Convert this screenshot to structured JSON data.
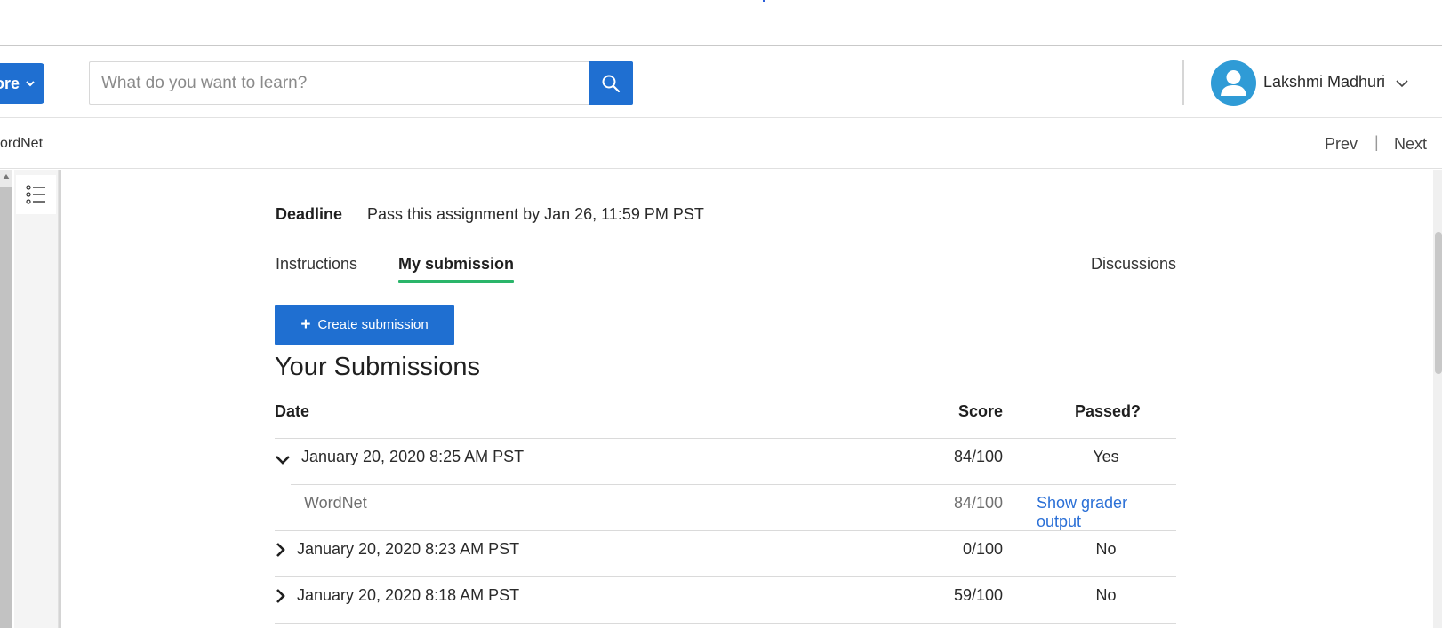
{
  "header": {
    "explore_label": "ore",
    "search_placeholder": "What do you want to learn?",
    "user_name": "Lakshmi Madhuri"
  },
  "subbar": {
    "breadcrumb": "ordNet",
    "prev_label": "Prev",
    "separator": "|",
    "next_label": "Next"
  },
  "assignment": {
    "deadline_label": "Deadline",
    "deadline_text": "Pass this assignment by Jan 26, 11:59 PM PST"
  },
  "tabs": [
    {
      "label": "Instructions",
      "active": false
    },
    {
      "label": "My submission",
      "active": true
    },
    {
      "label": "Discussions",
      "active": false
    }
  ],
  "create_submission_label": "Create submission",
  "submissions": {
    "title": "Your Submissions",
    "columns": {
      "date": "Date",
      "score": "Score",
      "passed": "Passed?"
    },
    "rows": [
      {
        "date": "January 20, 2020 8:25 AM PST",
        "score": "84/100",
        "passed": "Yes",
        "expanded": true,
        "detail": {
          "name": "WordNet",
          "score": "84/100",
          "link": "Show grader output"
        }
      },
      {
        "date": "January 20, 2020 8:23 AM PST",
        "score": "0/100",
        "passed": "No",
        "expanded": false
      },
      {
        "date": "January 20, 2020 8:18 AM PST",
        "score": "59/100",
        "passed": "No",
        "expanded": false
      }
    ]
  },
  "colors": {
    "primary_blue": "#1f6fd1",
    "tab_underline_green": "#2ab56a",
    "link_blue": "#2a6fd6",
    "avatar_blue": "#2f9bd6"
  },
  "icons": {
    "explore_chevron": "chevron-down-icon",
    "search": "search-icon",
    "avatar": "user-avatar-icon",
    "user_menu": "chevron-down-icon",
    "toc": "list-icon",
    "expand": "chevron-down-icon",
    "collapse": "chevron-right-icon",
    "create": "plus-icon"
  }
}
